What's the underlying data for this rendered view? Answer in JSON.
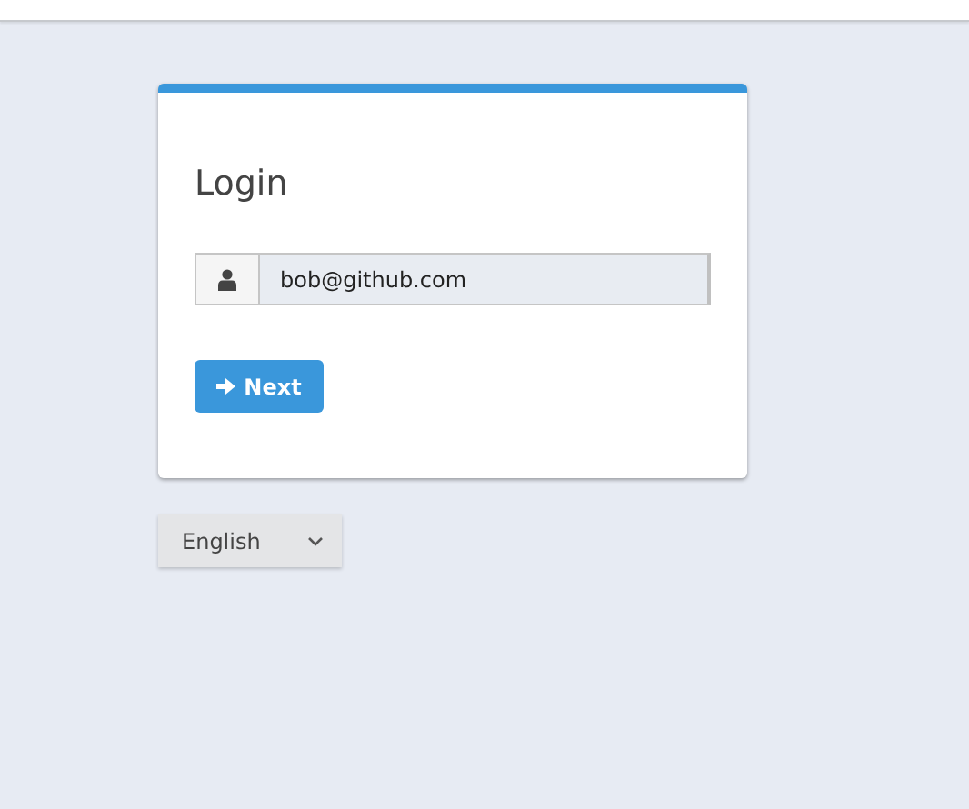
{
  "login": {
    "title": "Login",
    "username": {
      "value": "bob@github.com"
    },
    "next_button": {
      "label": "Next"
    }
  },
  "language_select": {
    "value": "English"
  }
}
